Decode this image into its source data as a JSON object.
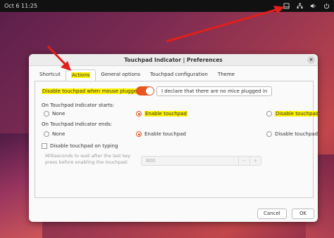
{
  "topbar": {
    "clock": "Oct 6  11:25"
  },
  "dialog": {
    "title": "Touchpad Indicator | Preferences",
    "close_glyph": "×",
    "tabs": [
      "Shortcut",
      "Actions",
      "General options",
      "Touchpad configuration",
      "Theme"
    ],
    "active_tab": "Actions",
    "disable_when_mouse": {
      "label": "Disable touchpad when mouse plugged",
      "toggle_on": true
    },
    "declare_button": "I declare that there are no mice plugged in",
    "on_start": {
      "label": "On Touchpad Indicator starts:",
      "options": [
        "None",
        "Enable touchpad",
        "Disable touchpad"
      ],
      "selected": "Enable touchpad"
    },
    "on_end": {
      "label": "On Touchpad Indicator ends:",
      "options": [
        "None",
        "Enable touchpad",
        "Disable touchpad"
      ],
      "selected": "Enable touchpad"
    },
    "disable_on_typing": {
      "label": "Disable touchpad on typing",
      "checked": false
    },
    "ms_wait": {
      "label": "Milliseconds to wait after the last key press before enabling the touchpad:",
      "value": "800",
      "minus": "−",
      "plus": "+"
    },
    "buttons": {
      "cancel": "Cancel",
      "ok": "OK"
    }
  },
  "colors": {
    "accent": "#e95420",
    "highlight": "#fff200",
    "arrow": "#e0201a"
  }
}
